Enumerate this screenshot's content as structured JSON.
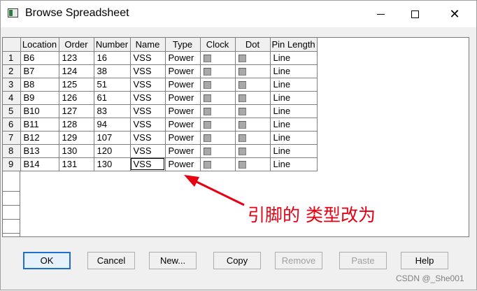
{
  "window": {
    "title": "Browse Spreadsheet"
  },
  "grid": {
    "columns": [
      "Location",
      "Order",
      "Number",
      "Name",
      "Type",
      "Clock",
      "Dot",
      "Pin Length"
    ],
    "rows": [
      {
        "n": "1",
        "location": "B6",
        "order": "123",
        "number": "16",
        "name": "VSS",
        "type": "Power",
        "pin_length": "Line"
      },
      {
        "n": "2",
        "location": "B7",
        "order": "124",
        "number": "38",
        "name": "VSS",
        "type": "Power",
        "pin_length": "Line"
      },
      {
        "n": "3",
        "location": "B8",
        "order": "125",
        "number": "51",
        "name": "VSS",
        "type": "Power",
        "pin_length": "Line"
      },
      {
        "n": "4",
        "location": "B9",
        "order": "126",
        "number": "61",
        "name": "VSS",
        "type": "Power",
        "pin_length": "Line"
      },
      {
        "n": "5",
        "location": "B10",
        "order": "127",
        "number": "83",
        "name": "VSS",
        "type": "Power",
        "pin_length": "Line"
      },
      {
        "n": "6",
        "location": "B11",
        "order": "128",
        "number": "94",
        "name": "VSS",
        "type": "Power",
        "pin_length": "Line"
      },
      {
        "n": "7",
        "location": "B12",
        "order": "129",
        "number": "107",
        "name": "VSS",
        "type": "Power",
        "pin_length": "Line"
      },
      {
        "n": "8",
        "location": "B13",
        "order": "130",
        "number": "120",
        "name": "VSS",
        "type": "Power",
        "pin_length": "Line"
      },
      {
        "n": "9",
        "location": "B14",
        "order": "131",
        "number": "130",
        "name": "VSS",
        "type": "Power",
        "pin_length": "Line"
      }
    ]
  },
  "annotation": {
    "text": "引脚的 类型改为",
    "color": "#e60012"
  },
  "buttons": {
    "ok": "OK",
    "cancel": "Cancel",
    "new": "New...",
    "copy": "Copy",
    "remove": "Remove",
    "paste": "Paste",
    "help": "Help"
  },
  "watermark": "CSDN @_She001"
}
